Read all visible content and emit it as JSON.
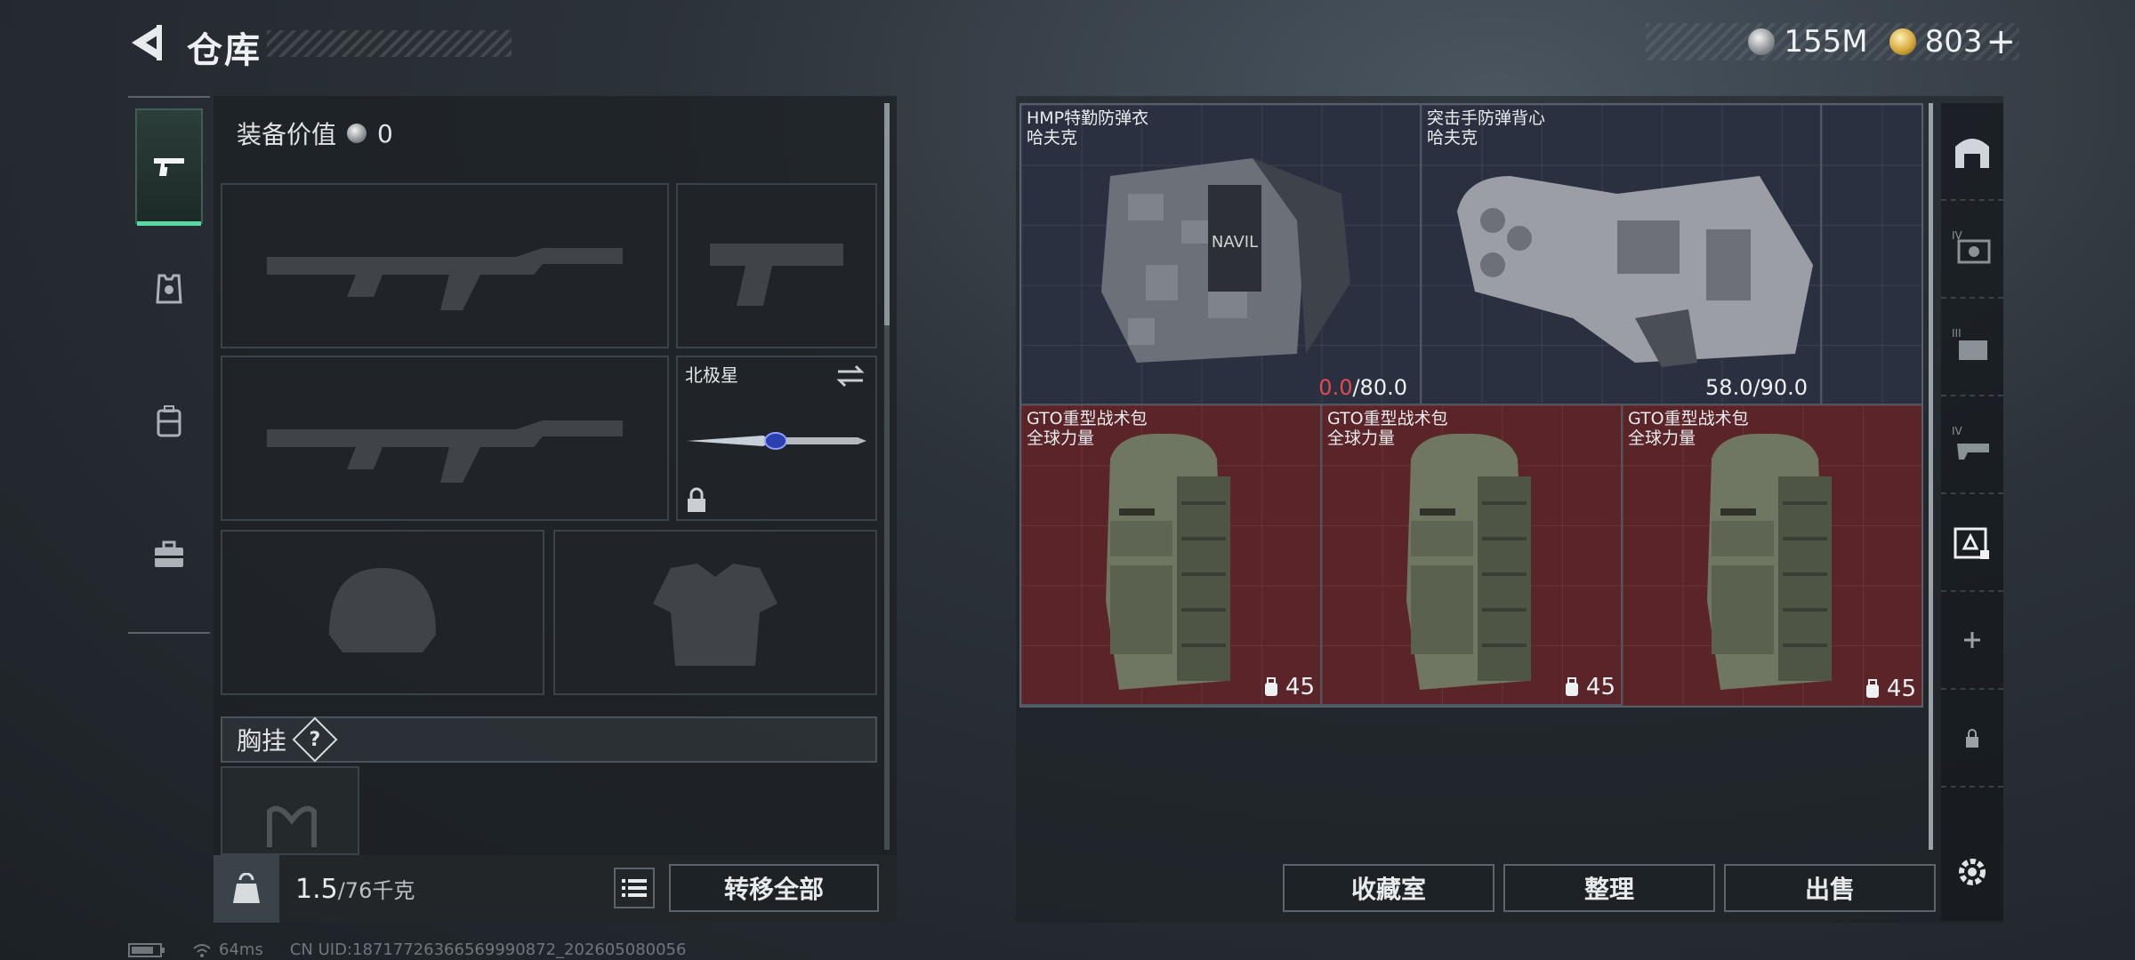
{
  "header": {
    "title": "仓库",
    "currency_silver": "155M",
    "currency_gold": "803",
    "add_symbol": "+"
  },
  "left": {
    "equip_value_label": "装备价值",
    "equip_value": "0",
    "melee_slot_label": "北极星",
    "chest_rig_label": "胸挂",
    "chest_help": "?",
    "weight_current": "1.5",
    "weight_max": "/76千克",
    "transfer_all": "转移全部"
  },
  "items": [
    {
      "name": "HMP特勤防弹衣",
      "brand": "哈夫克",
      "durability_current": "0.0",
      "durability_max": "/80.0",
      "type": "armor"
    },
    {
      "name": "突击手防弹背心",
      "brand": "哈夫克",
      "durability_current": "58.0",
      "durability_max": "/90.0",
      "type": "armor"
    },
    {
      "name": "GTO重型战术包",
      "brand": "全球力量",
      "count": "45",
      "type": "backpack"
    },
    {
      "name": "GTO重型战术包",
      "brand": "全球力量",
      "count": "45",
      "type": "backpack"
    },
    {
      "name": "GTO重型战术包",
      "brand": "全球力量",
      "count": "45",
      "type": "backpack"
    }
  ],
  "buttons": {
    "collection": "收藏室",
    "sort": "整理",
    "sell": "出售"
  },
  "status": {
    "ping": "64ms",
    "uid": "CN UID:18717726366569990872_202605080056"
  },
  "colors": {
    "accent_green": "#57d9a3",
    "vest_bg": "#2b3040",
    "bag_bg": "#5a2429",
    "durability_low": "#e5484d"
  }
}
